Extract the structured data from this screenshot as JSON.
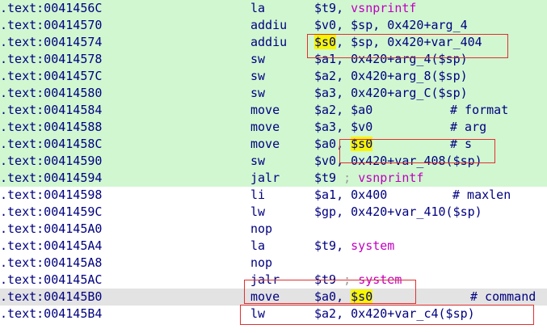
{
  "colors": {
    "executed_bg": "#d1f7d1",
    "selected_bg": "#e3e3e3",
    "text": "#000080",
    "symbol": "#c000c0",
    "highlight": "#f6f600",
    "annotation_box": "#e03030"
  },
  "rows": [
    {
      "addr": ".text:0041456C",
      "mn": "la",
      "ops": [
        {
          "t": "$t9, "
        },
        {
          "t": "vsnprintf",
          "c": "fn"
        }
      ],
      "bg": "green"
    },
    {
      "addr": ".text:00414570",
      "mn": "addiu",
      "ops": [
        {
          "t": "$v0, $sp, 0x420+arg_4"
        }
      ],
      "bg": "green"
    },
    {
      "addr": ".text:00414574",
      "mn": "addiu",
      "ops": [
        {
          "t": "$s0",
          "c": "hl"
        },
        {
          "t": ", $sp, 0x420+var_404"
        }
      ],
      "bg": "green"
    },
    {
      "addr": ".text:00414578",
      "mn": "sw",
      "ops": [
        {
          "t": "$a1, 0x420+arg_4($sp)"
        }
      ],
      "bg": "green"
    },
    {
      "addr": ".text:0041457C",
      "mn": "sw",
      "ops": [
        {
          "t": "$a2, 0x420+arg_8($sp)"
        }
      ],
      "bg": "green"
    },
    {
      "addr": ".text:00414580",
      "mn": "sw",
      "ops": [
        {
          "t": "$a3, 0x420+arg_C($sp)"
        }
      ],
      "bg": "green"
    },
    {
      "addr": ".text:00414584",
      "mn": "move",
      "ops": [
        {
          "t": "$a2, $a0"
        }
      ],
      "cmt": "# format",
      "bg": "green"
    },
    {
      "addr": ".text:00414588",
      "mn": "move",
      "ops": [
        {
          "t": "$a3, $v0"
        }
      ],
      "cmt": "# arg",
      "bg": "green"
    },
    {
      "addr": ".text:0041458C",
      "mn": "move",
      "ops": [
        {
          "t": "$a0, "
        },
        {
          "t": "$s0",
          "c": "hl"
        }
      ],
      "cmt": "# s",
      "bg": "green"
    },
    {
      "addr": ".text:00414590",
      "mn": "sw",
      "ops": [
        {
          "t": "$v0, 0x420+var_408($sp)"
        }
      ],
      "bg": "green"
    },
    {
      "addr": ".text:00414594",
      "mn": "jalr",
      "ops": [
        {
          "t": "$t9 "
        },
        {
          "t": "; ",
          "c": "semi"
        },
        {
          "t": "vsnprintf",
          "c": "fn"
        }
      ],
      "bg": "green"
    },
    {
      "addr": ".text:00414598",
      "mn": "li",
      "ops": [
        {
          "t": "$a1, 0x400"
        }
      ],
      "cmt": "# maxlen",
      "bg": "white"
    },
    {
      "addr": ".text:0041459C",
      "mn": "lw",
      "ops": [
        {
          "t": "$gp, 0x420+var_410($sp)"
        }
      ],
      "bg": "white"
    },
    {
      "addr": ".text:004145A0",
      "mn": "nop",
      "ops": [],
      "bg": "white"
    },
    {
      "addr": ".text:004145A4",
      "mn": "la",
      "ops": [
        {
          "t": "$t9, "
        },
        {
          "t": "system",
          "c": "fn"
        }
      ],
      "bg": "white"
    },
    {
      "addr": ".text:004145A8",
      "mn": "nop",
      "ops": [],
      "bg": "white"
    },
    {
      "addr": ".text:004145AC",
      "mn": "jalr",
      "ops": [
        {
          "t": "$t9 "
        },
        {
          "t": "; ",
          "c": "semi"
        },
        {
          "t": "system",
          "c": "fn"
        }
      ],
      "bg": "white"
    },
    {
      "addr": ".text:004145B0",
      "mn": "move",
      "ops": [
        {
          "t": "$a0, "
        },
        {
          "t": "$s0",
          "c": "hl"
        }
      ],
      "cmt": "# command",
      "bg": "sel"
    },
    {
      "addr": ".text:004145B4",
      "mn": "lw",
      "ops": [
        {
          "t": "$a2, 0x420+var_c4($sp)"
        }
      ],
      "bg": "white"
    }
  ]
}
